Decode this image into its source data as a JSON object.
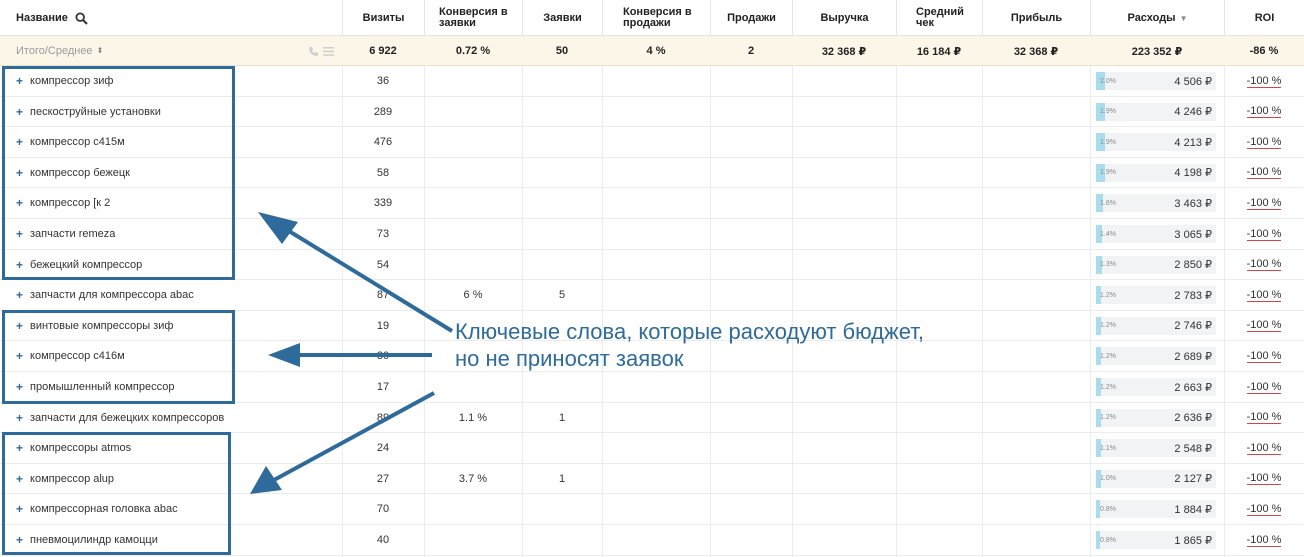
{
  "columns": {
    "name": "Название",
    "visits": "Визиты",
    "conv_leads_1": "Конверсия в",
    "conv_leads_2": "заявки",
    "leads": "Заявки",
    "conv_sales_1": "Конверсия в",
    "conv_sales_2": "продажи",
    "sales": "Продажи",
    "revenue": "Выручка",
    "avg_check_1": "Средний",
    "avg_check_2": "чек",
    "profit": "Прибыль",
    "costs": "Расходы",
    "roi": "ROI"
  },
  "totals": {
    "label": "Итого/Среднее",
    "visits": "6 922",
    "conv_leads": "0.72 %",
    "leads": "50",
    "conv_sales": "4 %",
    "sales": "2",
    "revenue": "32 368 ₽",
    "avg_check": "16 184 ₽",
    "profit": "32 368 ₽",
    "costs": "223 352 ₽",
    "roi": "-86 %"
  },
  "rows": [
    {
      "name": "компрессор зиф",
      "visits": "36",
      "conv_leads": "",
      "leads": "",
      "cost_share": "2.0%",
      "share_value": 0.02,
      "costs": "4 506 ₽",
      "roi": "-100 %"
    },
    {
      "name": "пескоструйные установки",
      "visits": "289",
      "conv_leads": "",
      "leads": "",
      "cost_share": "1.9%",
      "share_value": 0.019,
      "costs": "4 246 ₽",
      "roi": "-100 %"
    },
    {
      "name": "компрессор с415м",
      "visits": "476",
      "conv_leads": "",
      "leads": "",
      "cost_share": "1.9%",
      "share_value": 0.019,
      "costs": "4 213 ₽",
      "roi": "-100 %"
    },
    {
      "name": "компрессор бежецк",
      "visits": "58",
      "conv_leads": "",
      "leads": "",
      "cost_share": "1.9%",
      "share_value": 0.019,
      "costs": "4 198 ₽",
      "roi": "-100 %"
    },
    {
      "name": "компрессор [к 2",
      "visits": "339",
      "conv_leads": "",
      "leads": "",
      "cost_share": "1.6%",
      "share_value": 0.016,
      "costs": "3 463 ₽",
      "roi": "-100 %"
    },
    {
      "name": "запчасти remeza",
      "visits": "73",
      "conv_leads": "",
      "leads": "",
      "cost_share": "1.4%",
      "share_value": 0.014,
      "costs": "3 065 ₽",
      "roi": "-100 %"
    },
    {
      "name": "бежецкий компрессор",
      "visits": "54",
      "conv_leads": "",
      "leads": "",
      "cost_share": "1.3%",
      "share_value": 0.013,
      "costs": "2 850 ₽",
      "roi": "-100 %"
    },
    {
      "name": "запчасти для компрессора abac",
      "visits": "87",
      "conv_leads": "6 %",
      "leads": "5",
      "cost_share": "1.2%",
      "share_value": 0.012,
      "costs": "2 783 ₽",
      "roi": "-100 %"
    },
    {
      "name": "винтовые компрессоры зиф",
      "visits": "19",
      "conv_leads": "",
      "leads": "",
      "cost_share": "1.2%",
      "share_value": 0.012,
      "costs": "2 746 ₽",
      "roi": "-100 %"
    },
    {
      "name": "компрессор с416м",
      "visits": "30",
      "conv_leads": "",
      "leads": "",
      "cost_share": "1.2%",
      "share_value": 0.012,
      "costs": "2 689 ₽",
      "roi": "-100 %"
    },
    {
      "name": "промышленный компрессор",
      "visits": "17",
      "conv_leads": "",
      "leads": "",
      "cost_share": "1.2%",
      "share_value": 0.012,
      "costs": "2 663 ₽",
      "roi": "-100 %"
    },
    {
      "name": "запчасти для бежецких компрессоров",
      "visits": "89",
      "conv_leads": "1.1 %",
      "leads": "1",
      "cost_share": "1.2%",
      "share_value": 0.012,
      "costs": "2 636 ₽",
      "roi": "-100 %"
    },
    {
      "name": "компрессоры atmos",
      "visits": "24",
      "conv_leads": "",
      "leads": "",
      "cost_share": "1.1%",
      "share_value": 0.011,
      "costs": "2 548 ₽",
      "roi": "-100 %"
    },
    {
      "name": "компрессор alup",
      "visits": "27",
      "conv_leads": "3.7 %",
      "leads": "1",
      "cost_share": "1.0%",
      "share_value": 0.01,
      "costs": "2 127 ₽",
      "roi": "-100 %"
    },
    {
      "name": "компрессорная головка abac",
      "visits": "70",
      "conv_leads": "",
      "leads": "",
      "cost_share": "0.8%",
      "share_value": 0.008,
      "costs": "1 884 ₽",
      "roi": "-100 %"
    },
    {
      "name": "пневмоцилиндр камоцци",
      "visits": "40",
      "conv_leads": "",
      "leads": "",
      "cost_share": "0.8%",
      "share_value": 0.008,
      "costs": "1 865 ₽",
      "roi": "-100 %"
    }
  ],
  "annotation": {
    "line1": "Ключевые слова, которые расходуют бюджет,",
    "line2": "но не приносят заявок"
  },
  "colors": {
    "annotation": "#2f6b9a",
    "totals_bg": "#fbf6e8",
    "cost_bar": "#a9dcec",
    "roi_underline": "#d0454a"
  },
  "icons": {
    "search": "search-icon",
    "sort": "sort-icon",
    "phone": "phone-icon",
    "list": "list-icon",
    "expand": "plus-icon"
  }
}
